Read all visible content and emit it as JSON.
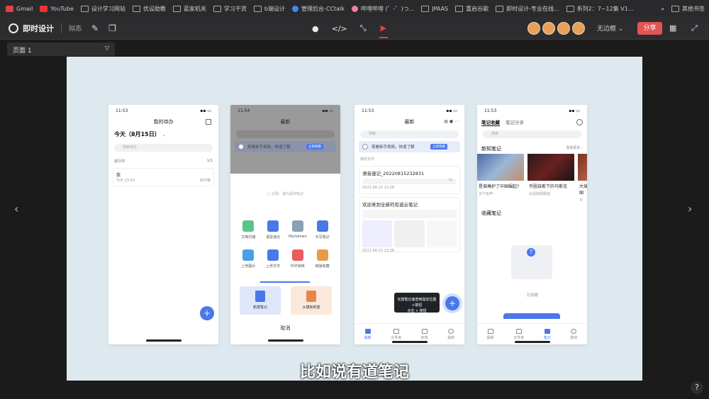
{
  "bookmarks": {
    "items": [
      {
        "label": "Gmail",
        "icon": "gmail-icon"
      },
      {
        "label": "YouTube",
        "icon": "youtube-icon"
      },
      {
        "label": "设计学习网站",
        "icon": "folder-icon"
      },
      {
        "label": "优设助教",
        "icon": "folder-icon"
      },
      {
        "label": "蓝家机关",
        "icon": "folder-icon"
      },
      {
        "label": "学习干货",
        "icon": "folder-icon"
      },
      {
        "label": "b端设计",
        "icon": "folder-icon"
      },
      {
        "label": "管理后台-CCtalk",
        "icon": "cctalk-icon"
      },
      {
        "label": "哔哩哔哩 (゜-゜)つ...",
        "icon": "bilibili-icon"
      },
      {
        "label": "JPAAS",
        "icon": "page-icon"
      },
      {
        "label": "重启谷歌",
        "icon": "globe-icon"
      },
      {
        "label": "即时设计-专业在线...",
        "icon": "jsdesign-icon"
      },
      {
        "label": "系列2：7~12集 V1...",
        "icon": "check-icon"
      }
    ],
    "overflow": "»",
    "other": "其他书签"
  },
  "toolbar": {
    "app_name": "即时设计",
    "mode": "拟态",
    "no_border": "无边框",
    "share": "分享"
  },
  "page_selector": {
    "value": "页面 1"
  },
  "subtitle": "比如说有道笔记",
  "help": "?",
  "phone1": {
    "time": "11:53",
    "title": "我的待办",
    "date": "今天（8月15日）",
    "search": "搜索待办",
    "section": "进行中",
    "count": "1/1",
    "task": "我",
    "task_meta": "今天 23:59",
    "task_tag": "收件箱",
    "fab": "+"
  },
  "phone2": {
    "time": "11:54",
    "title": "最新",
    "banner": "观看新手视频，快速了解",
    "banner_btn": "立即观看",
    "hint": "记录，或为素材笔记",
    "items": [
      {
        "label": "文档扫描",
        "color": "#5bc48a"
      },
      {
        "label": "语音速记",
        "color": "#4a78e8"
      },
      {
        "label": "Markdown",
        "color": "#8aa0b5"
      },
      {
        "label": "手写笔记",
        "color": "#4a78e8"
      },
      {
        "label": "上传图片",
        "color": "#4a9fe8"
      },
      {
        "label": "上传文件",
        "color": "#4a78e8"
      },
      {
        "label": "PDF转换",
        "color": "#e85d5d"
      },
      {
        "label": "链接收藏",
        "color": "#e89a4a"
      }
    ],
    "new_note": "新建笔记",
    "template": "从模板新建",
    "cancel": "取消"
  },
  "phone3": {
    "time": "11:53",
    "title": "最新",
    "search": "搜索",
    "banner": "观看新手视频，快速了解",
    "banner_btn": "立即观看",
    "section": "我的文件",
    "note1_title": "语音速记_20220815232831",
    "note1_meta": "2022-08-15 23:28",
    "note1_audio": "1s",
    "note2_title": "欢迎来到全新的有道云笔记",
    "note2_meta": "2022-08-15 23:28",
    "tooltip": "长按笔记速查到指定位置+按钮",
    "tooltip2": "点击 + 按钮",
    "fab": "+",
    "tabs": [
      "最新",
      "文件夹",
      "标签",
      "我的"
    ]
  },
  "phone4": {
    "time": "11:53",
    "tab_active": "笔记收藏",
    "tab_other": "笔记分享",
    "search": "搜索",
    "new_section": "新知笔记",
    "more": "查看更多 ›",
    "card1_title": "是谁掩护了中国崛起?",
    "card1_meta": "天下有声",
    "card2_title": "币圈自断下的马斯克",
    "card2_meta": "白话财经频道",
    "card3_title": "大城市中国",
    "card3_meta": "半",
    "collect_section": "收藏笔记",
    "empty": "无收藏",
    "tabs": [
      "最新",
      "文件夹",
      "笔记",
      "我的"
    ]
  }
}
